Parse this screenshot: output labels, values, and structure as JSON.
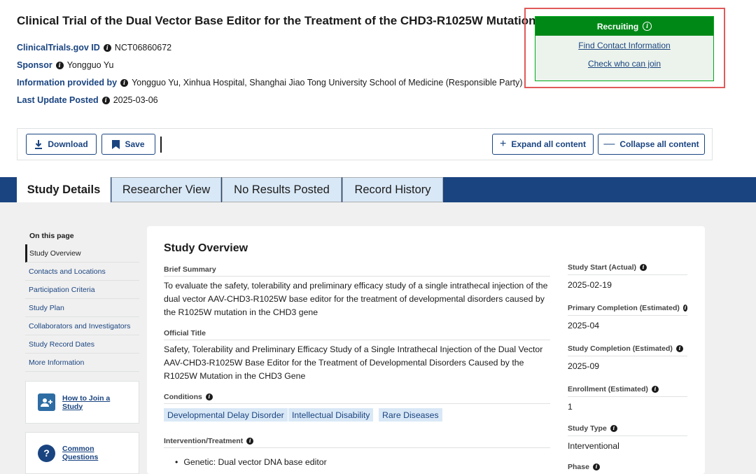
{
  "title": "Clinical Trial of the Dual Vector Base Editor for the Treatment of the CHD3-R1025W Mutation",
  "meta": [
    {
      "label": "ClinicalTrials.gov ID",
      "value": "NCT06860672"
    },
    {
      "label": "Sponsor",
      "value": "Yongguo Yu"
    },
    {
      "label": "Information provided by",
      "value": "Yongguo Yu, Xinhua Hospital, Shanghai Jiao Tong University School of Medicine (Responsible Party)"
    },
    {
      "label": "Last Update Posted",
      "value": "2025-03-06"
    }
  ],
  "recruit": {
    "status": "Recruiting",
    "links": [
      "Find Contact Information",
      "Check who can join"
    ],
    "status_color": "#008817"
  },
  "toolbar": {
    "download": "Download",
    "save": "Save",
    "expand": "Expand all content",
    "collapse": "Collapse all content"
  },
  "tabs": [
    "Study Details",
    "Researcher View",
    "No Results Posted",
    "Record History"
  ],
  "sidebar": {
    "heading": "On this page",
    "items": [
      "Study Overview",
      "Contacts and Locations",
      "Participation Criteria",
      "Study Plan",
      "Collaborators and Investigators",
      "Study Record Dates",
      "More Information"
    ],
    "cards": [
      "How to Join a Study",
      "Common Questions"
    ]
  },
  "overview": {
    "title": "Study Overview",
    "brief_label": "Brief Summary",
    "brief": "To evaluate the safety, tolerability and preliminary efficacy study of a single intrathecal injection of the dual vector AAV-CHD3-R1025W base editor for the treatment of developmental disorders caused by the R1025W mutation in the CHD3 gene",
    "official_label": "Official Title",
    "official": "Safety, Tolerability and Preliminary Efficacy Study of a Single Intrathecal Injection of the Dual Vector AAV-CHD3-R1025W Base Editor for the Treatment of Developmental Disorders Caused by the R1025W Mutation in the CHD3 Gene",
    "conditions_label": "Conditions",
    "conditions": [
      "Developmental Delay Disorder",
      "Intellectual Disability",
      "Rare Diseases"
    ],
    "intervention_label": "Intervention/Treatment",
    "intervention": "Genetic: Dual vector DNA base editor"
  },
  "facts": [
    {
      "label": "Study Start (Actual)",
      "value": "2025-02-19"
    },
    {
      "label": "Primary Completion (Estimated)",
      "value": "2025-04"
    },
    {
      "label": "Study Completion (Estimated)",
      "value": "2025-09"
    },
    {
      "label": "Enrollment (Estimated)",
      "value": "1"
    },
    {
      "label": "Study Type",
      "value": "Interventional"
    },
    {
      "label": "Phase",
      "value": ""
    }
  ],
  "colors": {
    "brand": "#1a4480",
    "chip_bg": "#d9e8f6",
    "highlight": "#e05a5a"
  }
}
